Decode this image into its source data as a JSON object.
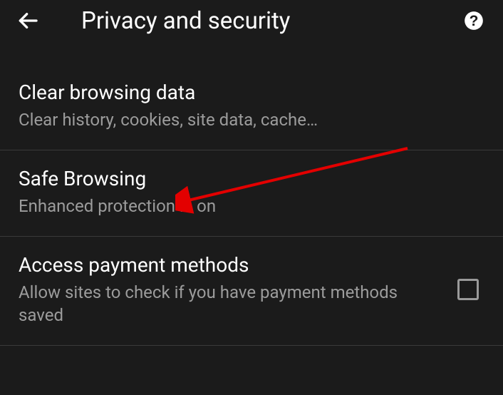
{
  "header": {
    "title": "Privacy and security"
  },
  "items": [
    {
      "title": "Clear browsing data",
      "subtitle": "Clear history, cookies, site data, cache…"
    },
    {
      "title": "Safe Browsing",
      "subtitle": "Enhanced protection is on"
    },
    {
      "title": "Access payment methods",
      "subtitle": "Allow sites to check if you have payment methods saved"
    }
  ]
}
